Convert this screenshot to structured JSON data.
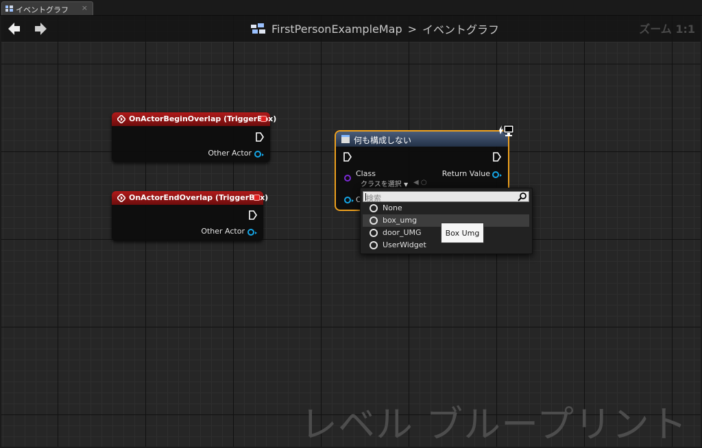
{
  "tab": {
    "label": "イベントグラフ",
    "close": "×"
  },
  "header": {
    "map_name": "FirstPersonExampleMap",
    "separator": ">",
    "graph_name": "イベントグラフ",
    "zoom": "ズーム 1:1"
  },
  "watermark": "レベル ブループリント",
  "nodes": {
    "begin_overlap": {
      "title": "OnActorBeginOverlap (TriggerBox)",
      "pin_label": "Other Actor"
    },
    "end_overlap": {
      "title": "OnActorEndOverlap (TriggerBox)",
      "pin_label": "Other Actor"
    },
    "create_widget": {
      "title": "何も構成しない",
      "class_label": "Class",
      "class_value": "クラスを選択",
      "return_label": "Return Value",
      "owner_label": "O"
    }
  },
  "dropdown": {
    "search_placeholder": "検索",
    "options": [
      {
        "label": "None"
      },
      {
        "label": "box_umg"
      },
      {
        "label": "door_UMG"
      },
      {
        "label": "UserWidget"
      }
    ],
    "tooltip": "Box Umg"
  },
  "colors": {
    "event_header": "#b01a1a",
    "function_header": "#4b5d79",
    "object_pin": "#15a7e8",
    "class_pin": "#7b2ad6",
    "selection": "#f0a21e"
  }
}
